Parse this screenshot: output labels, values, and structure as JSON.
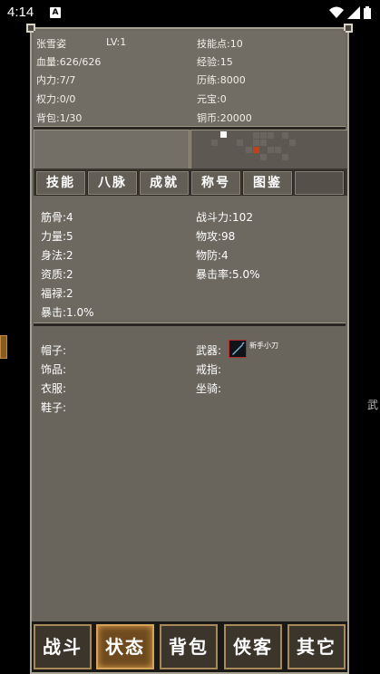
{
  "status_bar": {
    "time": "4:14",
    "notification": "A"
  },
  "edge_right_text": "武",
  "info": {
    "name": "张雪姿",
    "level": "LV:1",
    "skill_points": "技能点:10",
    "hp": "血量:626/626",
    "exp": "经验:15",
    "internal": "内力:7/7",
    "experience": "历练:8000",
    "power": "权力:0/0",
    "yuanbao": "元宝:0",
    "bag": "背包:1/30",
    "coins": "铜币:20000"
  },
  "tabs": [
    "技能",
    "八脉",
    "成就",
    "称号",
    "图鉴"
  ],
  "stats_left": [
    "筋骨:4",
    "力量:5",
    "身法:2",
    "资质:2",
    "福禄:2",
    "暴击:1.0%"
  ],
  "stats_right": [
    "战斗力:102",
    "物攻:98",
    "物防:4",
    "暴击率:5.0%"
  ],
  "equipment": {
    "hat": "帽子:",
    "accessory": "饰品:",
    "clothes": "衣服:",
    "shoes": "鞋子:",
    "weapon": "武器:",
    "weapon_item": "新手小刀",
    "ring": "戒指:",
    "mount": "坐骑:"
  },
  "bottom_nav": [
    "战斗",
    "状态",
    "背包",
    "侠客",
    "其它"
  ],
  "active_nav": 1,
  "colors": {
    "frame_bg": "#6b665e",
    "active_tab": "#6e4a1e",
    "weapon_border": "#b52b2b",
    "map_marker": "#c0421c"
  }
}
